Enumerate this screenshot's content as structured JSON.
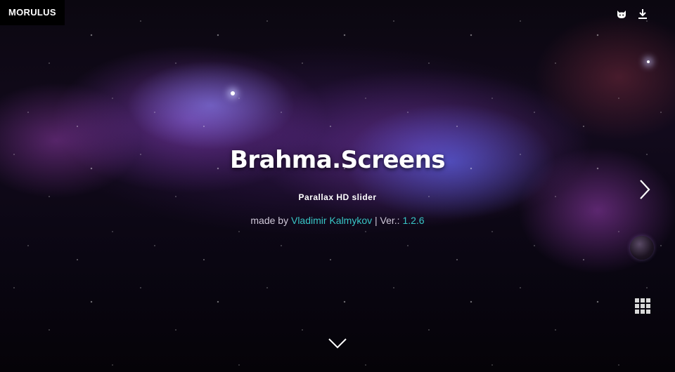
{
  "brand": {
    "name": "MORULUS"
  },
  "header_icons": [
    {
      "icon": "github-cat-icon"
    },
    {
      "icon": "download-icon"
    }
  ],
  "hero": {
    "title": "Brahma.Screens",
    "subtitle": "Parallax HD slider",
    "credit_prefix": "made by ",
    "author": "Vladimir Kalmykov",
    "separator": " | Ver.: ",
    "version": "1.2.6"
  },
  "controls": {
    "next_icon": "chevron-right-icon",
    "menu_icon": "grid-icon",
    "scroll_icon": "chevron-down-icon"
  },
  "colors": {
    "accent_link": "#38c6c6",
    "text_muted": "#cfc8d8",
    "background": "#07050d"
  }
}
